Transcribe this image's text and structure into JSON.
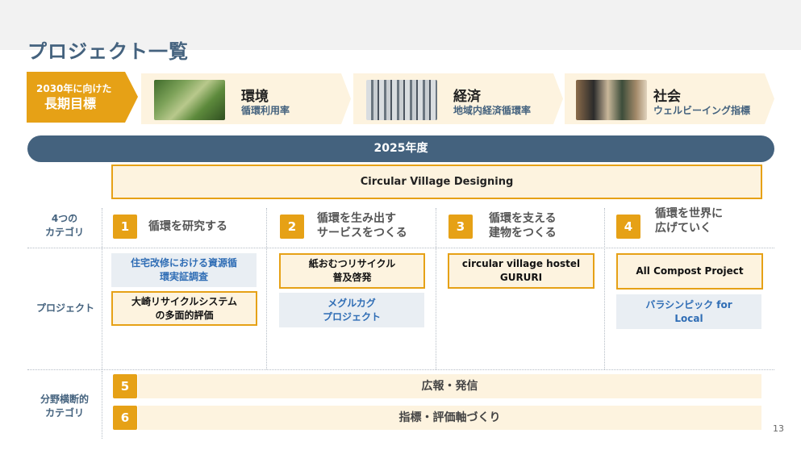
{
  "title": "プロジェクト一覧",
  "goals_label": {
    "line1": "2030年に向けた",
    "line2": "長期目標"
  },
  "goals": [
    {
      "name": "環境",
      "sub": "循環利用率",
      "photo": "tea-leaves-photo"
    },
    {
      "name": "経済",
      "sub": "地域内経済循環率",
      "photo": "group-photo"
    },
    {
      "name": "社会",
      "sub": "ウェルビーイング指標",
      "photo": "community-photo"
    }
  ],
  "year": "2025年度",
  "designing": "Circular Village Designing",
  "row_labels": {
    "categories": "4つの\nカテゴリ",
    "projects": "プロジェクト",
    "cross": "分野横断的\nカテゴリ"
  },
  "categories": [
    {
      "num": "1",
      "label": "循環を研究する"
    },
    {
      "num": "2",
      "label": "循環を生み出す\nサービスをつくる"
    },
    {
      "num": "3",
      "label": "循環を支える\n建物をつくる"
    },
    {
      "num": "4",
      "label": "循環を世界に\n広げていく"
    }
  ],
  "projects": {
    "c1_a": "住宅改修における資源循\n環実証調査",
    "c1_b": "大崎リサイクルシステム\nの多面的評価",
    "c2_a": "紙おむつリサイクル\n普及啓発",
    "c2_b": "メグルカグ\nプロジェクト",
    "c3_a": "circular village hostel\nGURURI",
    "c4_a": "All Compost Project",
    "c4_b": "バラシンピック for\nLocal"
  },
  "cross": [
    {
      "num": "5",
      "label": "広報・発信"
    },
    {
      "num": "6",
      "label": "指標・評価軸づくり"
    }
  ],
  "page_number": "13",
  "colors": {
    "accent": "#e6a116",
    "navy": "#44627e",
    "cream": "#fdf3df",
    "link_blue": "#2f6db5"
  }
}
